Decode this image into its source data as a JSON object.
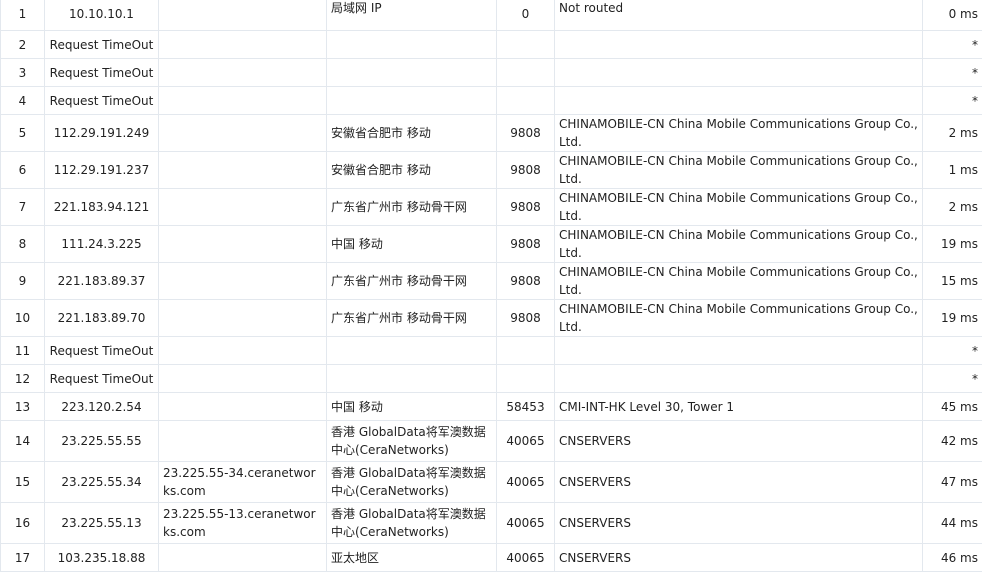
{
  "rows": [
    {
      "hop": "1",
      "ip": "10.10.10.1",
      "host": "",
      "loc": "局域网 IP",
      "asn": "0",
      "org": "Not routed",
      "time": "0 ms"
    },
    {
      "hop": "2",
      "ip": "Request TimeOut",
      "host": "",
      "loc": "",
      "asn": "",
      "org": "",
      "time": "*"
    },
    {
      "hop": "3",
      "ip": "Request TimeOut",
      "host": "",
      "loc": "",
      "asn": "",
      "org": "",
      "time": "*"
    },
    {
      "hop": "4",
      "ip": "Request TimeOut",
      "host": "",
      "loc": "",
      "asn": "",
      "org": "",
      "time": "*"
    },
    {
      "hop": "5",
      "ip": "112.29.191.249",
      "host": "",
      "loc": "安徽省合肥市 移动",
      "asn": "9808",
      "org": "CHINAMOBILE-CN China Mobile Communications Group Co., Ltd.",
      "time": "2 ms"
    },
    {
      "hop": "6",
      "ip": "112.29.191.237",
      "host": "",
      "loc": "安徽省合肥市 移动",
      "asn": "9808",
      "org": "CHINAMOBILE-CN China Mobile Communications Group Co., Ltd.",
      "time": "1 ms"
    },
    {
      "hop": "7",
      "ip": "221.183.94.121",
      "host": "",
      "loc": "广东省广州市 移动骨干网",
      "asn": "9808",
      "org": "CHINAMOBILE-CN China Mobile Communications Group Co., Ltd.",
      "time": "2 ms"
    },
    {
      "hop": "8",
      "ip": "111.24.3.225",
      "host": "",
      "loc": "中国 移动",
      "asn": "9808",
      "org": "CHINAMOBILE-CN China Mobile Communications Group Co., Ltd.",
      "time": "19 ms"
    },
    {
      "hop": "9",
      "ip": "221.183.89.37",
      "host": "",
      "loc": "广东省广州市 移动骨干网",
      "asn": "9808",
      "org": "CHINAMOBILE-CN China Mobile Communications Group Co., Ltd.",
      "time": "15 ms"
    },
    {
      "hop": "10",
      "ip": "221.183.89.70",
      "host": "",
      "loc": "广东省广州市 移动骨干网",
      "asn": "9808",
      "org": "CHINAMOBILE-CN China Mobile Communications Group Co., Ltd.",
      "time": "19 ms"
    },
    {
      "hop": "11",
      "ip": "Request TimeOut",
      "host": "",
      "loc": "",
      "asn": "",
      "org": "",
      "time": "*"
    },
    {
      "hop": "12",
      "ip": "Request TimeOut",
      "host": "",
      "loc": "",
      "asn": "",
      "org": "",
      "time": "*"
    },
    {
      "hop": "13",
      "ip": "223.120.2.54",
      "host": "",
      "loc": "中国 移动",
      "asn": "58453",
      "org": "CMI-INT-HK Level 30, Tower 1",
      "time": "45 ms"
    },
    {
      "hop": "14",
      "ip": "23.225.55.55",
      "host": "",
      "loc": "香港 GlobalData将军澳数据中心(CeraNetworks)",
      "asn": "40065",
      "org": "CNSERVERS",
      "time": "42 ms"
    },
    {
      "hop": "15",
      "ip": "23.225.55.34",
      "host": "23.225.55-34.ceranetworks.com",
      "loc": "香港 GlobalData将军澳数据中心(CeraNetworks)",
      "asn": "40065",
      "org": "CNSERVERS",
      "time": "47 ms"
    },
    {
      "hop": "16",
      "ip": "23.225.55.13",
      "host": "23.225.55-13.ceranetworks.com",
      "loc": "香港 GlobalData将军澳数据中心(CeraNetworks)",
      "asn": "40065",
      "org": "CNSERVERS",
      "time": "44 ms"
    },
    {
      "hop": "17",
      "ip": "103.235.18.88",
      "host": "",
      "loc": "亚太地区",
      "asn": "40065",
      "org": "CNSERVERS",
      "time": "46 ms"
    }
  ],
  "colors": {
    "border": "#e3e8ee",
    "text": "#222222"
  }
}
